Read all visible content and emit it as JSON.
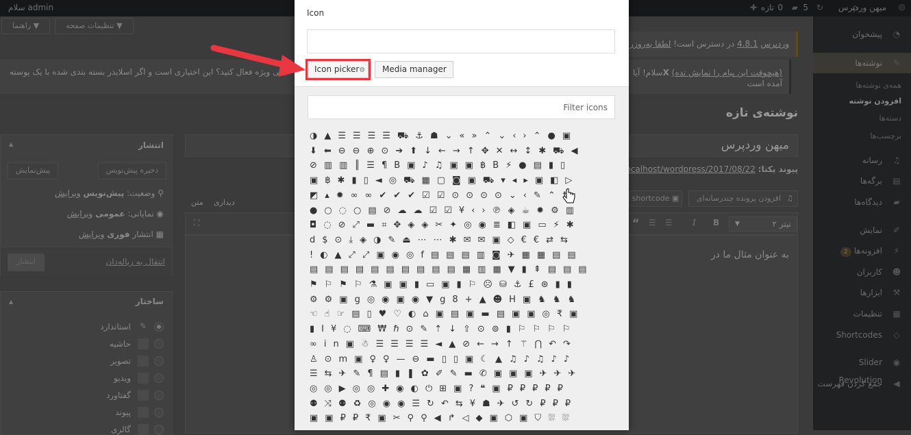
{
  "admin_bar": {
    "site_name": "میهن وردپرس",
    "updates_count": "5",
    "comments_count": "0",
    "new_label": "تازه",
    "greeting": "سلام admin"
  },
  "screen_meta": {
    "screen_options": "تنظیمات صفحه ▼",
    "help": "راهنما ▼"
  },
  "notices": {
    "update_prefix": "وردپرس",
    "update_version": "4.8.1",
    "update_text": "در دسترس است!",
    "update_link": "لطفا به‌روزر",
    "plugin_dismiss": "(هیچوقت این پیام را نمایش نده)",
    "plugin_x": "X",
    "plugin_text_right": "سلام! آیا",
    "plugin_text_right_line2": "آمده است",
    "plugin_text_left": "بانی ویژه فعال کنید؟ این اختیاری است و اگر اسلایدر بسته بندی شده با یک پوسته"
  },
  "sidebar": {
    "items": [
      {
        "label": "پیشخوان",
        "icon": "dashboard-icon",
        "glyph": "◔"
      },
      {
        "label": "نوشته‌ها",
        "icon": "pin-icon",
        "glyph": "✎",
        "active": true
      },
      {
        "label": "رسانه",
        "icon": "media-icon",
        "glyph": "♫"
      },
      {
        "label": "برگه‌ها",
        "icon": "pages-icon",
        "glyph": "▤"
      },
      {
        "label": "دیدگاه‌ها",
        "icon": "comments-icon",
        "glyph": "▰"
      },
      {
        "label": "نمایش",
        "icon": "appearance-icon",
        "glyph": "✐"
      },
      {
        "label": "افزونه‌ها",
        "icon": "plugins-icon",
        "glyph": "⚡",
        "badge": "2"
      },
      {
        "label": "کاربران",
        "icon": "users-icon",
        "glyph": "☻"
      },
      {
        "label": "ابزارها",
        "icon": "tools-icon",
        "glyph": "⚒"
      },
      {
        "label": "تنظیمات",
        "icon": "settings-icon",
        "glyph": "▦"
      },
      {
        "label": "Shortcodes",
        "icon": "code-icon",
        "glyph": "◇"
      },
      {
        "label": "Slider Revolution",
        "icon": "slider-icon",
        "glyph": "◉"
      },
      {
        "label": "جمع کردن فهرست",
        "icon": "collapse-icon",
        "glyph": "◀"
      }
    ],
    "submenu": [
      "همه‌ی نوشته‌ها",
      "افزودن نوشته",
      "دسته‌ها",
      "برچسب‌ها"
    ]
  },
  "editor": {
    "page_title": "نوشته‌ی تازه",
    "post_title": "میهن وردپرس",
    "permalink_label": "پیوند یکتا:",
    "permalink_url": "http://localhost/wordpress/2017/08/22",
    "add_media": "افزودن پرونده چندرسانه‌ای",
    "shortcode": "shortcode",
    "tab_visual": "دیداری",
    "tab_text": "متن",
    "format_select": "تیتر ۲",
    "content": "به عنوان مثال ما در"
  },
  "publish_box": {
    "title": "انتشار",
    "save_draft": "ذخیره پیش‌نویس",
    "preview": "پیش‌نمایش",
    "status_label": "وضعیت:",
    "status_value": "پیش‌نویس",
    "visibility_label": "نمایانی:",
    "visibility_value": "عمومی",
    "schedule_label": "انتشار",
    "schedule_value": "فوری",
    "edit": "ویرایش",
    "trash": "انتقال به زباله‌دان",
    "publish": "انتشار"
  },
  "format_box": {
    "title": "ساختار",
    "options": [
      "استاندارد",
      "حاشیه",
      "تصویر",
      "ویدیو",
      "گفتاورد",
      "پیوند",
      "گالری"
    ],
    "selected": "استاندارد"
  },
  "modal": {
    "field_label": "Icon",
    "field_value": "",
    "icon_picker": "Icon picker",
    "media_manager": "Media manager",
    "filter_placeholder": "Filter icons",
    "highlight_color": "#e8373f",
    "icon_rows": [
      "◑▲☰☰☰☰⛟⚓☗⌄«»⌃⌄‹›⌃●▣",
      "⬇⬅⊖⊖⊕⊙➔⬆↓←→↑✥✕↔↕✱⛟◀",
      "⊘▥▥║☰¶B▣♪♫▣▣฿B⚡●▤▮▯",
      "▣฿✱▮▯◄◎⛟▦▢◙▣⛟▾◂▸▣◧▷",
      "◩▴✹∞∞✔✔✔☑☑⊙⊙⊙⊙⌄‹✎⌃☨",
      "●○◌○▤⊘☁☁☑☑¥‹›℗◈☕✹⚙▥",
      "◘◌⊘⤢▬⌗✥◈◈✂✦◎◉≣◧▣▭⚡✱",
      "d$⊙⤓◈◑✎⏏⋯⋯✱✉✉▣◇€€⇄⇆",
      "!◐▲⤢⤢▣◉◎f▤▤▤▥◙✈▦▦▤▤",
      "▤▤▤▤▤▤▤▤▤▤▦▥▦▼▮⇞▤▤▤",
      "⚑⚐⚑⚐⚗▣▣▮▭▣▮⚐☹⛁⚓£⊛▮▮",
      "⚙⚙▣g◎◉▣◉▼g8+▲☻H▣♞♞♞",
      "☜☝☞▤▯♥♡◐⌂▣▤▣▬▤▣▣◎₹▣",
      "▮I¥◌⌨₩ℏ⊙✎⇡↓⇧⊙⊚▮⚐⚐⚐⚐",
      "∞in▣☃☰☰☰☰◄▲⊘←→↑⚚⋂↶↷",
      "♙⊙m▣♀♀—⊖▬▯▯▣☾▲♫♪♫♪♪",
      "☰⇆✈✎¶▤▮❚✿✐✎▬✆▣▣▣✈✈✈",
      "◎◎▶◎◎✚◉◐⏻⊞▣?❝▣₽₽₽₽₽",
      "⚉⤨⚉♻◎◉◉☰↻↶⇆¥☗✈↺↻₽₽₽",
      "▣▣₽₽₹▣✂⚲⚲◀↱◁◆▣⬡▣⛉⛆⛆"
    ]
  }
}
